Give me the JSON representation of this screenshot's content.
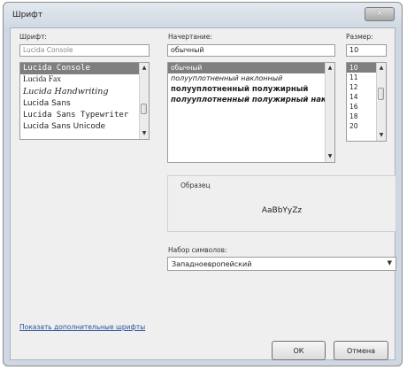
{
  "window": {
    "title": "Шрифт"
  },
  "font": {
    "label": "Шрифт:",
    "value": "Lucida Console",
    "items": [
      "Lucida Console",
      "Lucida Fax",
      "Lucida Handwriting",
      "Lucida Sans",
      "Lucida Sans Typewriter",
      "Lucida Sans Unicode"
    ]
  },
  "style": {
    "label": "Начертание:",
    "value": "обычный",
    "items": [
      "обычный",
      "полууплотненный наклонный",
      "полууплотненный полужирный",
      "полууплотненный полужирный наклонный"
    ]
  },
  "size": {
    "label": "Размер:",
    "value": "10",
    "items": [
      "10",
      "11",
      "12",
      "14",
      "16",
      "18",
      "20"
    ]
  },
  "sample": {
    "label": "Образец",
    "text": "AaBbYyZz"
  },
  "charset": {
    "label": "Набор символов:",
    "value": "Западноевропейский"
  },
  "more_fonts_link": "Показать дополнительные шрифты",
  "buttons": {
    "ok": "ОК",
    "cancel": "Отмена"
  }
}
